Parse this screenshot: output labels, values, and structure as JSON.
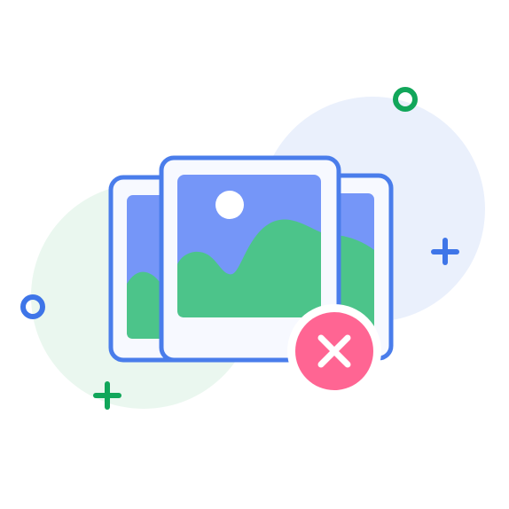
{
  "illustration": {
    "name": "no-images-error",
    "icons": [
      "photo-stack-icon",
      "close-icon",
      "sun-icon",
      "mountain-icon",
      "plus-icon",
      "ring-icon"
    ]
  },
  "colors": {
    "frame_stroke": "#4A7DEB",
    "frame_fill": "#F7F9FF",
    "sky": "#7596F8",
    "hills": "#4CC48A",
    "sun": "#FFFFFF",
    "error_badge": "#FF6593",
    "blob_blue": "#EAF0FC",
    "blob_green": "#EAF7EF",
    "accent_green": "#11A65A",
    "accent_blue": "#3E75E8"
  }
}
